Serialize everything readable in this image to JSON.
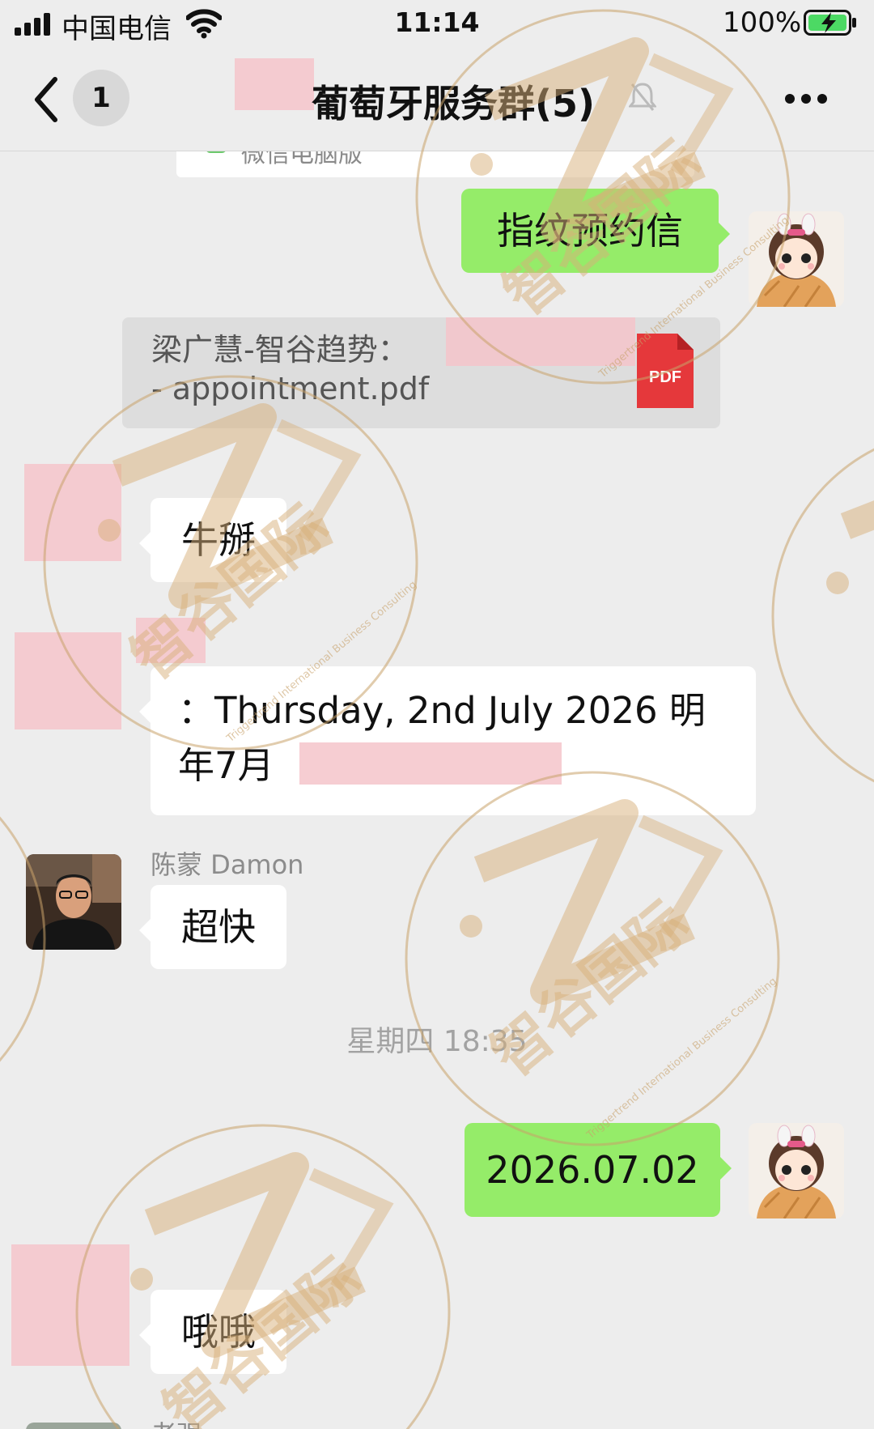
{
  "status_bar": {
    "carrier": "中国电信",
    "time": "11:14",
    "battery": "100%"
  },
  "nav": {
    "unread_count": "1",
    "title": "葡萄牙服务群(5)"
  },
  "messages": {
    "partial_card_text": "微信电脑版",
    "msg1": "指纹预约信",
    "file_line1": "梁广慧-智谷趋势：",
    "file_line2": " - appointment.pdf",
    "file_type": "PDF",
    "msg2": "牛掰",
    "msg3_line1": "：Thursday, 2nd July 2026  明",
    "msg3_line2": "年7月",
    "sender_damon": "陈蒙 Damon",
    "msg4": "超快",
    "time_separator": "星期四 18:35",
    "msg5": "2026.07.02",
    "msg6": "哦哦",
    "partial_sender": "老强"
  },
  "watermark": {
    "brand": "智谷国际",
    "tagline": "Triggertrend International Business Consulting"
  },
  "colors": {
    "chat_bg": "#ededed",
    "sent_bubble": "#95ec69",
    "received_bubble": "#ffffff",
    "pdf_red": "#e5383b",
    "watermark": "#c8a26a"
  }
}
